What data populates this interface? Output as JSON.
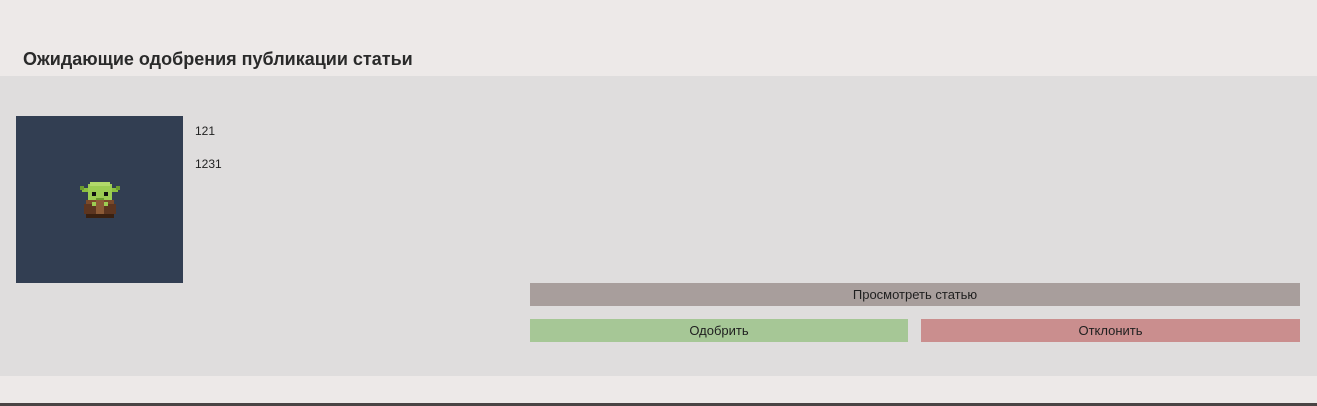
{
  "page": {
    "title": "Ожидающие одобрения публикации статьи"
  },
  "article": {
    "thumbnail_icon": "baby-yoda-pixel-icon",
    "title": "121",
    "description": "1231"
  },
  "actions": {
    "view_label": "Просмотреть статью",
    "approve_label": "Одобрить",
    "reject_label": "Отклонить"
  },
  "colors": {
    "background": "#ede9e8",
    "panel": "#dfdddd",
    "thumbnail_bg": "#323e52",
    "view_button": "#a89e9c",
    "approve_button": "#a6c796",
    "reject_button": "#ca8e8e"
  }
}
